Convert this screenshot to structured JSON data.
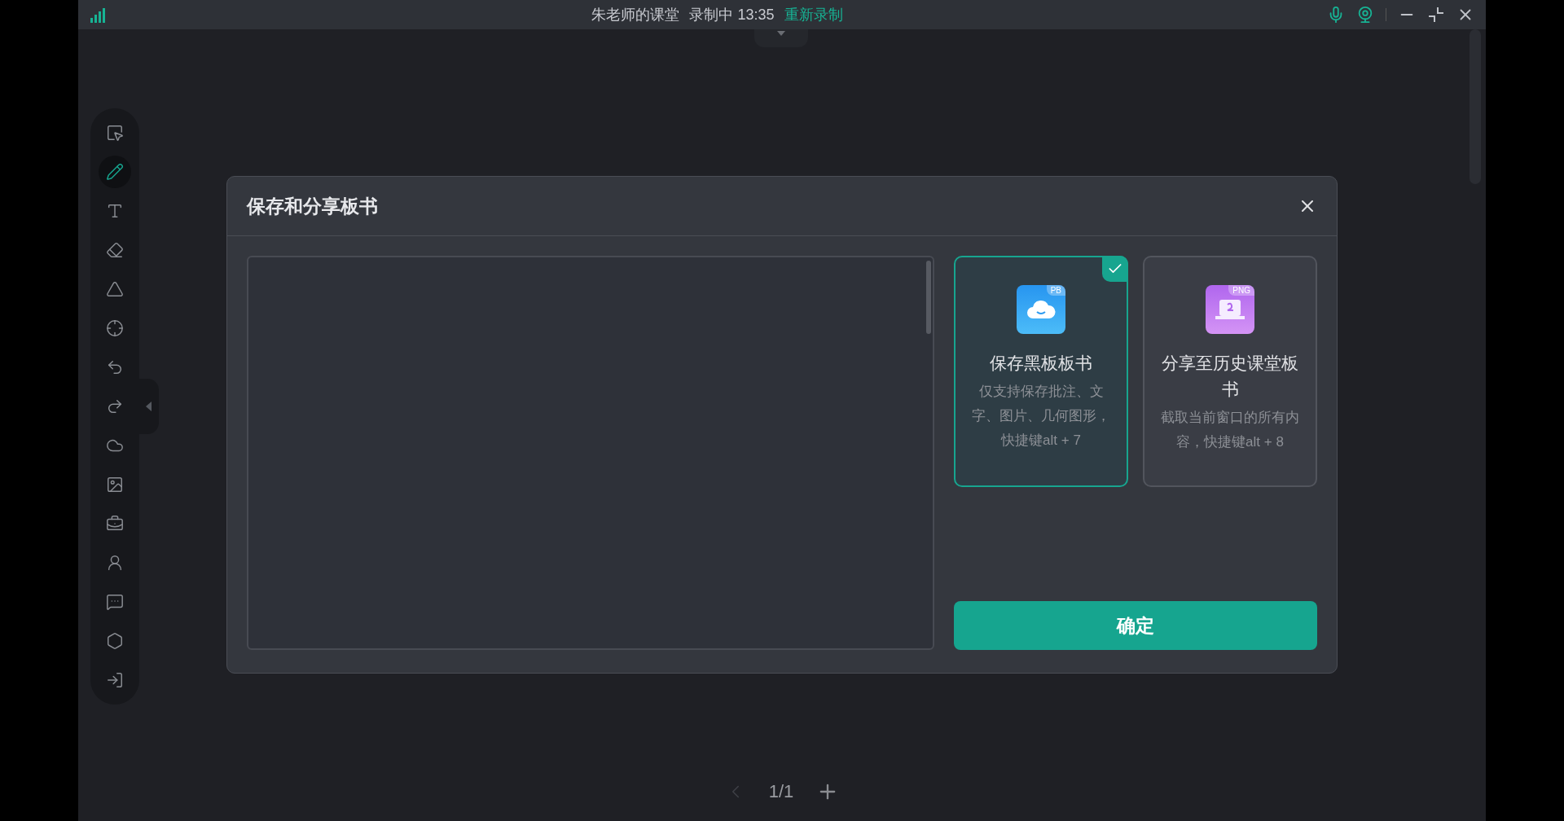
{
  "title_bar": {
    "class_name": "朱老师的课堂",
    "recording": "录制中 13:35",
    "rerecord": "重新录制"
  },
  "tools": [
    {
      "selected": false
    },
    {
      "selected": true
    },
    {
      "selected": false
    },
    {
      "selected": false
    },
    {
      "selected": false
    },
    {
      "selected": false
    },
    {
      "selected": false
    },
    {
      "selected": false
    },
    {
      "selected": false
    },
    {
      "selected": false
    },
    {
      "selected": false
    },
    {
      "selected": false
    },
    {
      "selected": false
    },
    {
      "selected": false
    },
    {
      "selected": false
    }
  ],
  "dialog": {
    "title": "保存和分享板书",
    "cards": [
      {
        "kind": "cloud",
        "badge": "PB",
        "title": "保存黑板板书",
        "description": "仅支持保存批注、文字、图片、几何图形，快捷键alt + 7",
        "selected": true
      },
      {
        "kind": "screen",
        "badge": "PNG",
        "title": "分享至历史课堂板书",
        "description": "截取当前窗口的所有内容，快捷键alt + 8",
        "selected": false
      }
    ],
    "confirm": "确定"
  },
  "pagination": {
    "page": "1/1"
  }
}
